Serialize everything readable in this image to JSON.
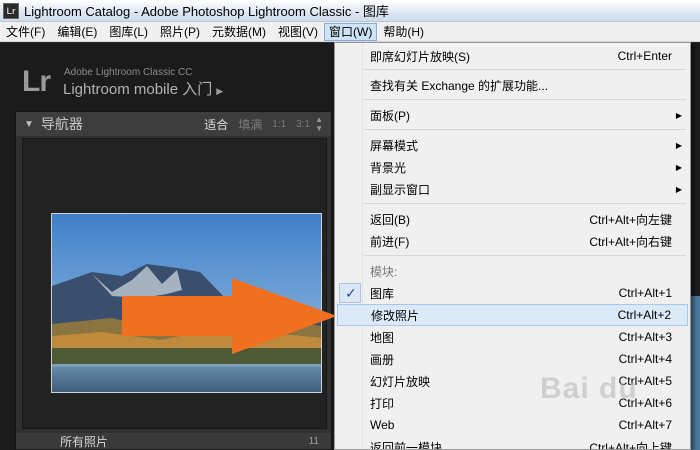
{
  "window": {
    "app_icon": "Lr",
    "title": "Lightroom Catalog - Adobe Photoshop Lightroom Classic - 图库"
  },
  "menubar": {
    "items": [
      {
        "label": "文件(F)"
      },
      {
        "label": "编辑(E)"
      },
      {
        "label": "图库(L)"
      },
      {
        "label": "照片(P)"
      },
      {
        "label": "元数据(M)"
      },
      {
        "label": "视图(V)"
      },
      {
        "label": "窗口(W)",
        "active": true
      },
      {
        "label": "帮助(H)"
      }
    ]
  },
  "lightroom": {
    "logo": "Lr",
    "brand_line1": "Adobe Lightroom Classic CC",
    "brand_line2": "Lightroom mobile 入门",
    "navigator": {
      "title": "导航器",
      "options": [
        "适合",
        "填满",
        "1:1",
        "3:1"
      ],
      "selected": "适合"
    },
    "collection": {
      "name": "所有照片",
      "count": "11"
    }
  },
  "window_menu": {
    "items": [
      {
        "label": "即席幻灯片放映(S)",
        "shortcut": "Ctrl+Enter"
      },
      {
        "label": "查找有关 Exchange 的扩展功能...",
        "shortcut": ""
      },
      {
        "label": "面板(P)",
        "submenu": true
      },
      {
        "label": "屏幕模式",
        "submenu": true
      },
      {
        "label": "背景光",
        "submenu": true
      },
      {
        "label": "副显示窗口",
        "submenu": true
      },
      {
        "label": "返回(B)",
        "shortcut": "Ctrl+Alt+向左键"
      },
      {
        "label": "前进(F)",
        "shortcut": "Ctrl+Alt+向右键"
      },
      {
        "label": "模块:",
        "heading": true
      },
      {
        "label": "图库",
        "shortcut": "Ctrl+Alt+1",
        "checked": true
      },
      {
        "label": "修改照片",
        "shortcut": "Ctrl+Alt+2",
        "highlighted": true
      },
      {
        "label": "地图",
        "shortcut": "Ctrl+Alt+3"
      },
      {
        "label": "画册",
        "shortcut": "Ctrl+Alt+4"
      },
      {
        "label": "幻灯片放映",
        "shortcut": "Ctrl+Alt+5"
      },
      {
        "label": "打印",
        "shortcut": "Ctrl+Alt+6"
      },
      {
        "label": "Web",
        "shortcut": "Ctrl+Alt+7"
      },
      {
        "label": "返回前一模块",
        "shortcut": "Ctrl+Alt+向上键"
      }
    ],
    "check_mark": "✓",
    "submenu_arrow": "▶"
  },
  "watermark": "Bai du",
  "colors": {
    "arrow": "#f07020",
    "highlight": "#dbeaf8",
    "check": "#1a4fa0"
  }
}
